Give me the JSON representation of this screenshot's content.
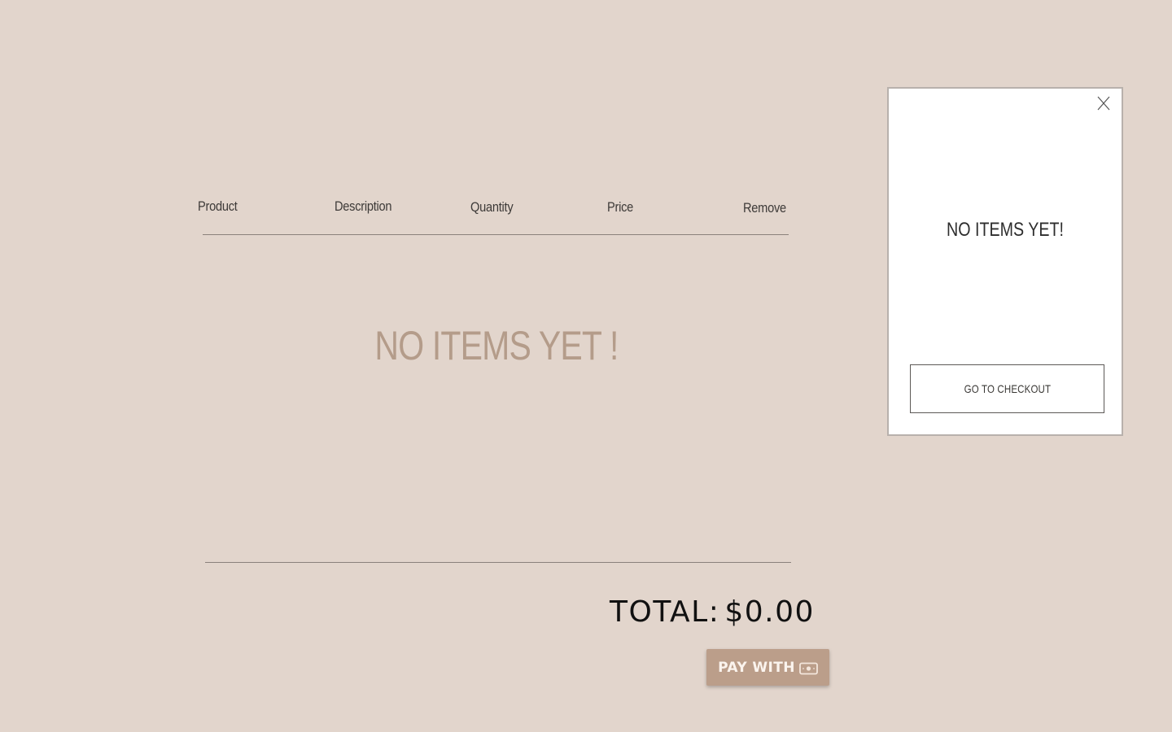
{
  "cart": {
    "columns": {
      "product": "Product",
      "description": "Description",
      "quantity": "Quantity",
      "price": "Price",
      "remove": "Remove"
    },
    "empty_message": "NO ITEMS YET !",
    "total_label": "TOTAL:",
    "total_value": "$0.00",
    "pay_button_label": "PAY WITH",
    "pay_icon": "cash-icon"
  },
  "mini_cart": {
    "close_icon": "close-icon",
    "empty_message": "NO ITEMS YET!",
    "checkout_label": "GO TO CHECKOUT"
  },
  "colors": {
    "page_background": "#e2d5cc",
    "accent": "#bb9e8a",
    "empty_text": "#b49c8a",
    "panel_background": "#ffffff"
  }
}
